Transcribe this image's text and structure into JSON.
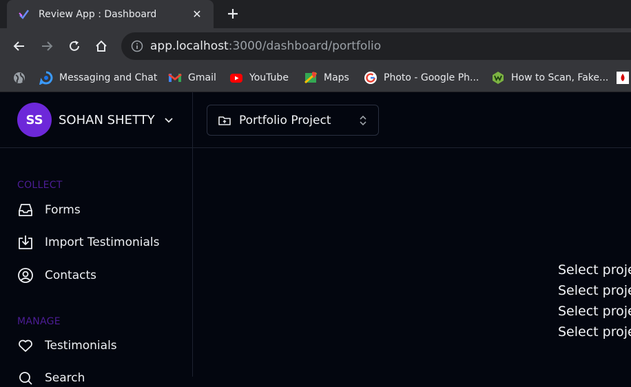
{
  "browser": {
    "tab": {
      "title": "Review App : Dashboard"
    },
    "url": {
      "host": "app.localhost",
      "rest": ":3000/dashboard/portfolio"
    },
    "bookmarks": [
      {
        "label": "",
        "icon": "globe-icon"
      },
      {
        "label": "Messaging and Chat",
        "icon": "chat-icon"
      },
      {
        "label": "Gmail",
        "icon": "gmail-icon"
      },
      {
        "label": "YouTube",
        "icon": "youtube-icon"
      },
      {
        "label": "Maps",
        "icon": "maps-icon"
      },
      {
        "label": "Photo - Google Ph...",
        "icon": "google-icon"
      },
      {
        "label": "How to Scan, Fake...",
        "icon": "w-logo-icon"
      }
    ]
  },
  "app": {
    "user": {
      "initials": "SS",
      "name": "SOHAN SHETTY"
    },
    "project": {
      "label": "Portfolio Project"
    },
    "sections": {
      "collect": "COLLECT",
      "manage": "MANAGE"
    },
    "nav": {
      "forms": "Forms",
      "import": "Import Testimonials",
      "contacts": "Contacts",
      "testimonials": "Testimonials",
      "search": "Search"
    },
    "main": {
      "placeholders": [
        "Select project",
        "Select project",
        "Select project",
        "Select project"
      ]
    },
    "colors": {
      "background": "#03060f",
      "accent": "#6d28d9",
      "section_label": "#4c1d95"
    }
  }
}
